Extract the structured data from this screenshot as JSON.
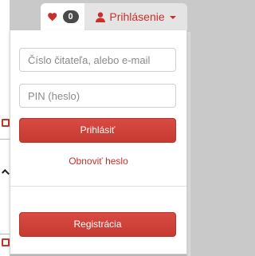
{
  "header": {
    "favorites_count": "0",
    "login_label": "Prihlásenie"
  },
  "login_form": {
    "user_placeholder": "Číslo čitateľa, alebo e-mail",
    "pin_placeholder": "PIN (heslo)",
    "login_button": "Prihlásiť",
    "reset_link": "Obnoviť heslo",
    "register_button": "Registrácia"
  },
  "colors": {
    "accent": "#c9302c",
    "button": "#d0423a",
    "badge": "#4a4a4a"
  }
}
